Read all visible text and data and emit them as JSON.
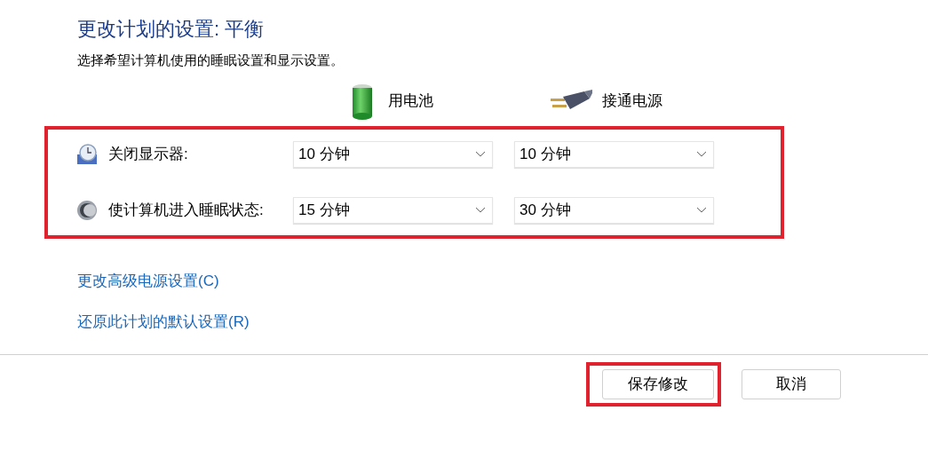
{
  "title": "更改计划的设置: 平衡",
  "subtitle": "选择希望计算机使用的睡眠设置和显示设置。",
  "columns": [
    {
      "kind": "battery",
      "label": "用电池"
    },
    {
      "kind": "plug",
      "label": "接通电源"
    }
  ],
  "settings": {
    "highlighted": true,
    "rows": [
      {
        "kind": "display",
        "label": "关闭显示器:",
        "values": [
          "10 分钟",
          "10 分钟"
        ]
      },
      {
        "kind": "sleep",
        "label": "使计算机进入睡眠状态:",
        "values": [
          "15 分钟",
          "30 分钟"
        ]
      }
    ]
  },
  "links": [
    "更改高级电源设置(C)",
    "还原此计划的默认设置(R)"
  ],
  "buttons": [
    {
      "label": "保存修改",
      "highlighted": true
    },
    {
      "label": "取消",
      "highlighted": false
    }
  ]
}
